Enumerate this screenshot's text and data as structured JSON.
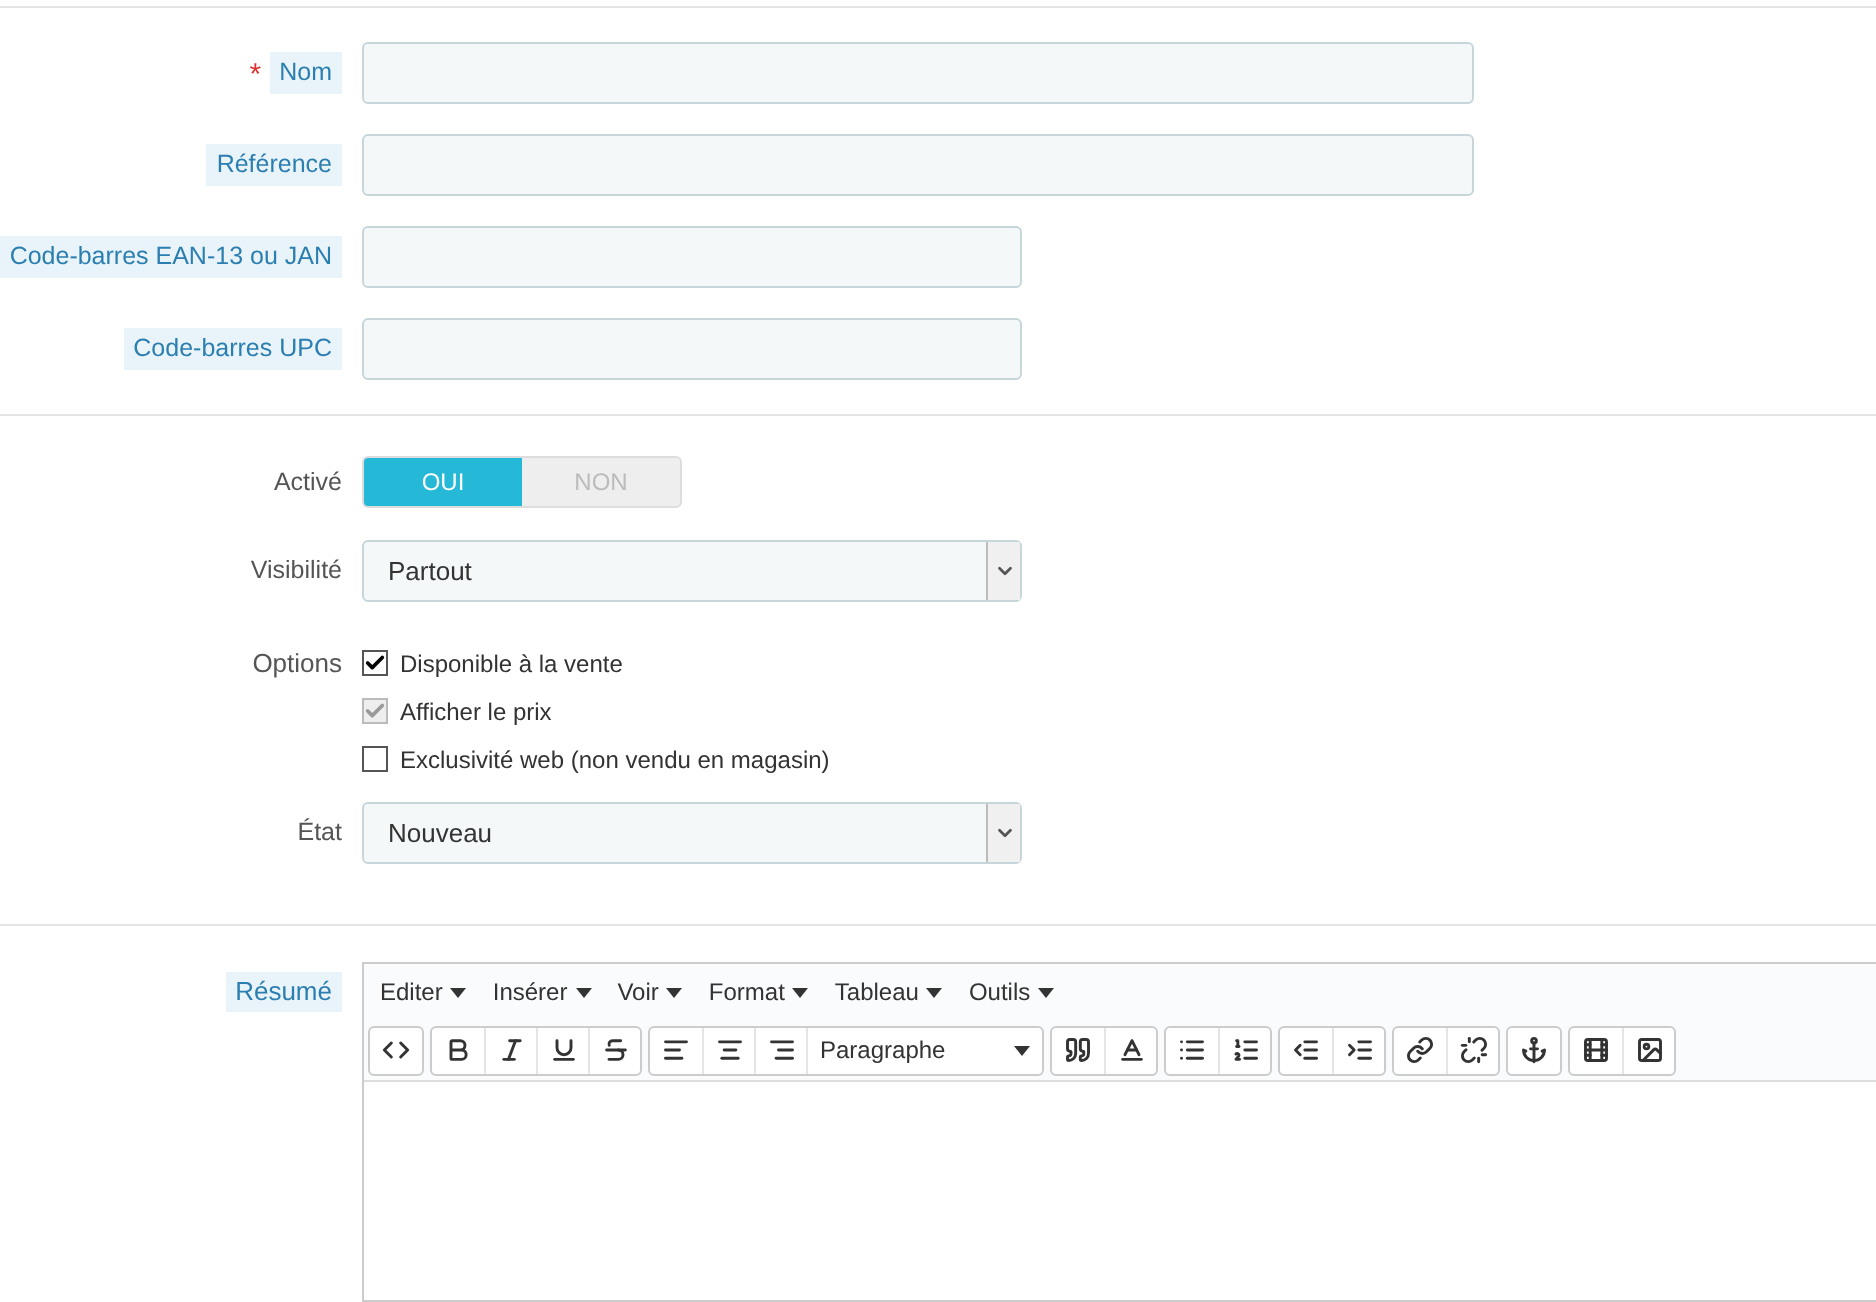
{
  "text_fields": [
    {
      "label": "Nom",
      "marker": "*",
      "hint": true,
      "wide": true
    },
    {
      "label": "Référence",
      "hint": true,
      "wide": true
    },
    {
      "label": "Code-barres EAN-13 ou JAN",
      "hint": true,
      "wide": false
    },
    {
      "label": "Code-barres UPC",
      "hint": true,
      "wide": false
    }
  ],
  "active": {
    "label": "Activé",
    "options": [
      {
        "label": "OUI",
        "selected": true
      },
      {
        "label": "NON",
        "selected": false
      }
    ]
  },
  "visibility": {
    "label": "Visibilité",
    "value": "Partout"
  },
  "options": {
    "label": "Options",
    "items": [
      {
        "label": "Disponible à la vente",
        "checked": true,
        "disabled": false
      },
      {
        "label": "Afficher le prix",
        "checked": true,
        "disabled": true
      },
      {
        "label": "Exclusivité web (non vendu en magasin)",
        "checked": false,
        "disabled": false
      }
    ]
  },
  "condition": {
    "label": "État",
    "value": "Nouveau"
  },
  "summary": {
    "label": "Résumé",
    "hint": true,
    "menu": [
      "Editer",
      "Insérer",
      "Voir",
      "Format",
      "Tableau",
      "Outils"
    ],
    "format_select": "Paragraphe"
  }
}
